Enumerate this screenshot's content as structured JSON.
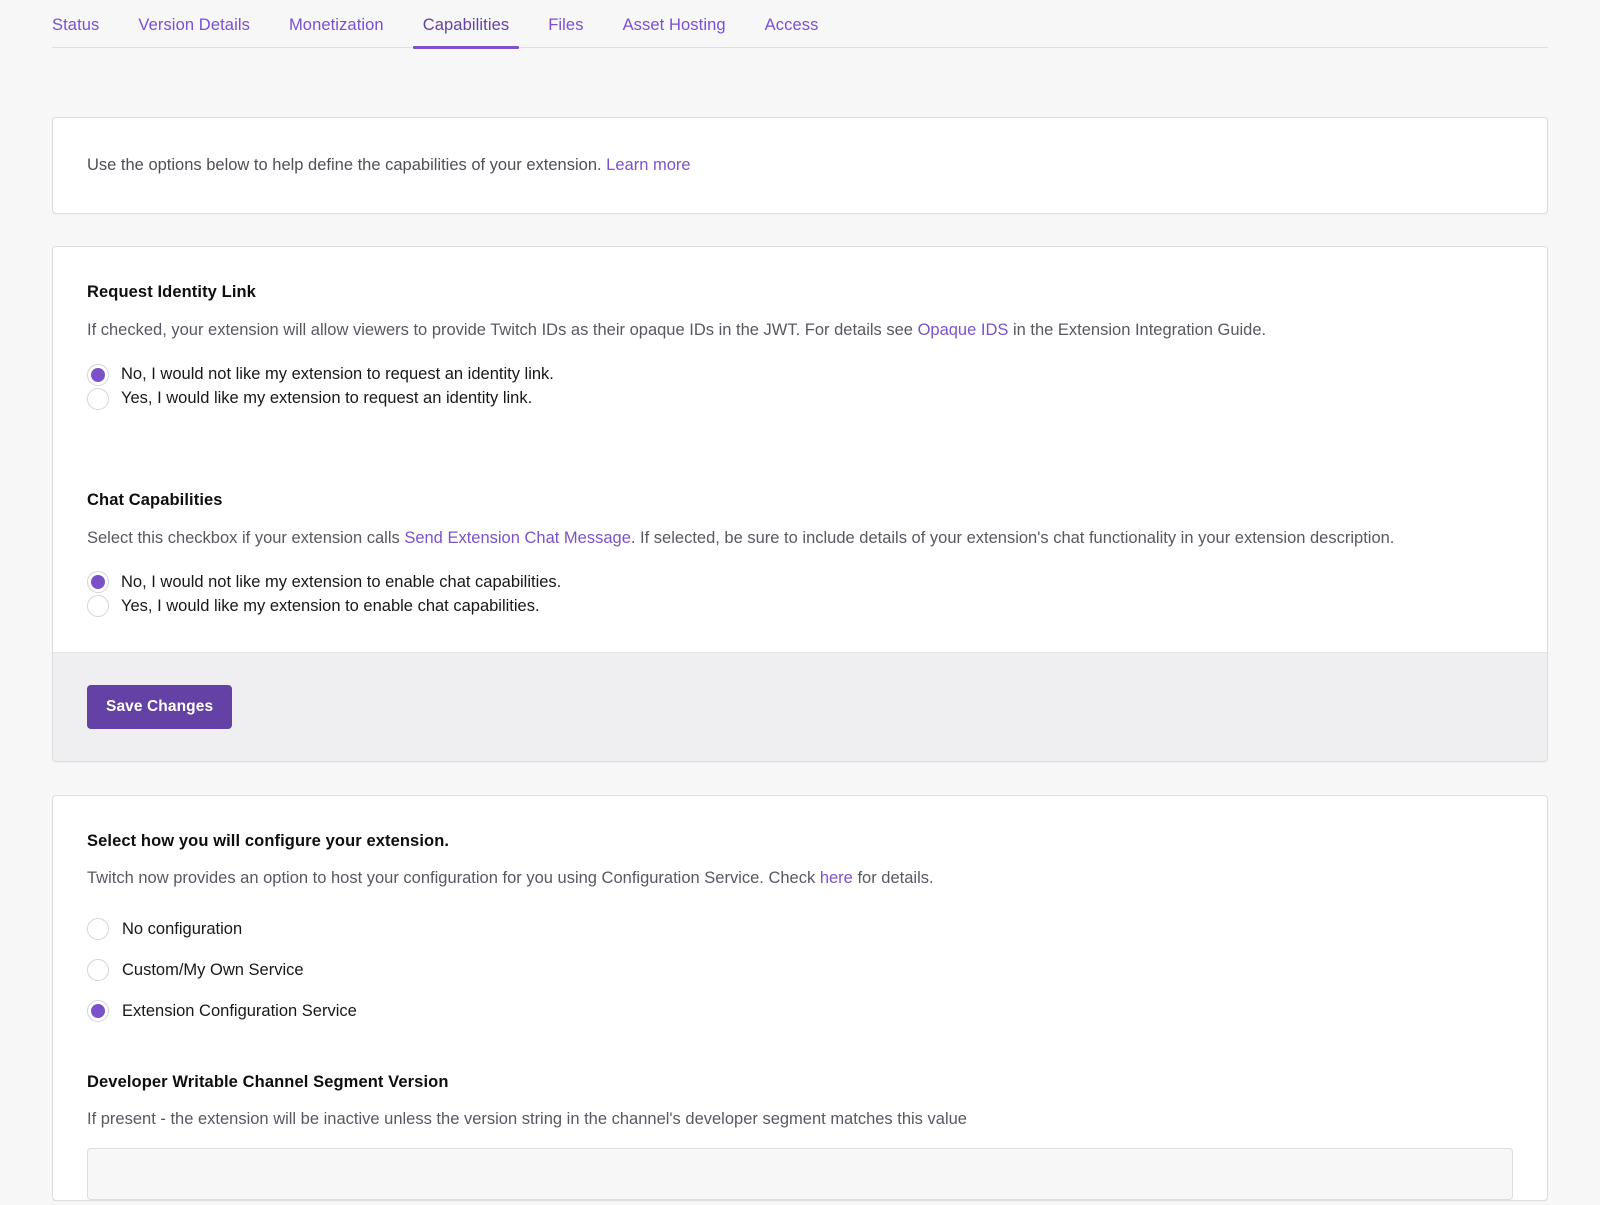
{
  "tabs": [
    {
      "label": "Status",
      "active": false
    },
    {
      "label": "Version Details",
      "active": false
    },
    {
      "label": "Monetization",
      "active": false
    },
    {
      "label": "Capabilities",
      "active": true
    },
    {
      "label": "Files",
      "active": false
    },
    {
      "label": "Asset Hosting",
      "active": false
    },
    {
      "label": "Access",
      "active": false
    }
  ],
  "info": {
    "text_before": "Use the options below to help define the capabilities of your extension.",
    "link_label": "Learn more"
  },
  "identity": {
    "title": "Request Identity Link",
    "desc_before": "If checked, your extension will allow viewers to provide Twitch IDs as their opaque IDs in the JWT. For details see ",
    "desc_link": "Opaque IDS",
    "desc_after": " in the Extension Integration Guide.",
    "options": [
      {
        "label": "No, I would not like my extension to request an identity link.",
        "selected": true
      },
      {
        "label": "Yes, I would like my extension to request an identity link.",
        "selected": false
      }
    ]
  },
  "chat": {
    "title": "Chat Capabilities",
    "desc_before": "Select this checkbox if your extension calls ",
    "desc_link": "Send Extension Chat Message",
    "desc_after": ". If selected, be sure to include details of your extension's chat functionality in your extension description.",
    "options": [
      {
        "label": "No, I would not like my extension to enable chat capabilities.",
        "selected": true
      },
      {
        "label": "Yes, I would like my extension to enable chat capabilities.",
        "selected": false
      }
    ]
  },
  "footer": {
    "save_label": "Save Changes",
    "accent_color": "#6441a4"
  },
  "configuration": {
    "title": "Select how you will configure your extension.",
    "desc_before": "Twitch now provides an option to host your configuration for you using Configuration Service. Check ",
    "desc_link": "here",
    "desc_after": " for details.",
    "options": [
      {
        "label": "No configuration",
        "selected": false
      },
      {
        "label": "Custom/My Own Service",
        "selected": false
      },
      {
        "label": "Extension Configuration Service",
        "selected": true
      }
    ]
  },
  "segment_version": {
    "title": "Developer Writable Channel Segment Version",
    "desc": "If present - the extension will be inactive unless the version string in the channel's developer segment matches this value",
    "value": "",
    "placeholder": ""
  },
  "colors": {
    "link": "#7b52cc",
    "radio_fill": "#7a51c8",
    "page_bg": "#f7f7f8",
    "footer_bg": "#efeff1"
  }
}
